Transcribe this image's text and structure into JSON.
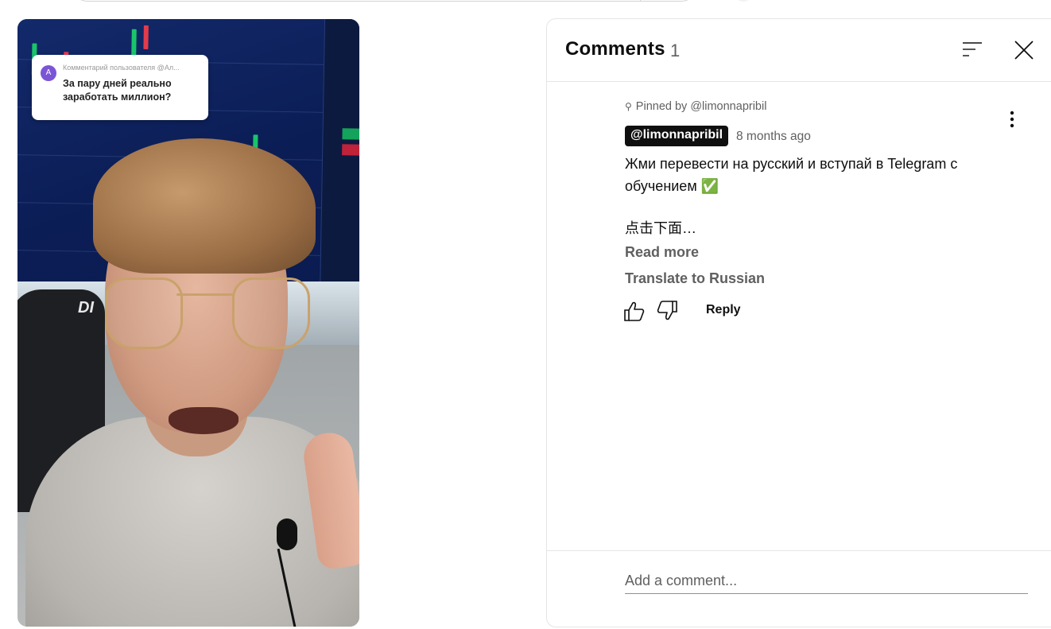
{
  "video": {
    "overlay": {
      "avatar_letter": "A",
      "user_line": "Комментарий пользователя @Ал...",
      "question": "За пару дней реально заработать миллион?"
    },
    "chair_text": "DI"
  },
  "comments_panel": {
    "title": "Comments",
    "count": "1",
    "icons": {
      "sort": "sort-icon",
      "close": "close-icon",
      "more": "more-vert-icon"
    },
    "comment": {
      "pinned_label": "Pinned by @limonnapribil",
      "author": "@limonnapribil",
      "timestamp": "8 months ago",
      "text": "Жми перевести на русский и вступай в Telegram с обучением ✅",
      "text_more": "点击下面…",
      "read_more": "Read more",
      "translate": "Translate to Russian",
      "reply": "Reply"
    },
    "add_comment_placeholder": "Add a comment..."
  },
  "colors": {
    "author_chip_bg": "#0f0f0f",
    "secondary_text": "#606060",
    "check_emoji_green": "#3aa33a",
    "avatar_purple": "#7b55d6"
  }
}
